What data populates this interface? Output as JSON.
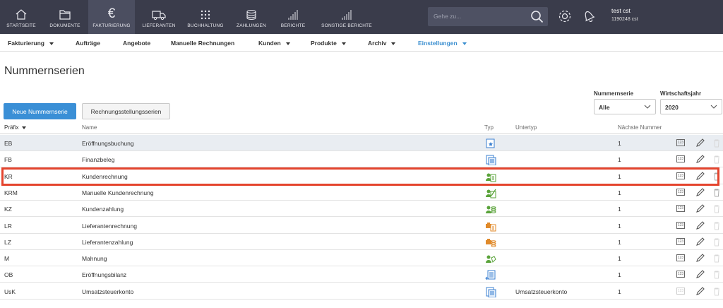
{
  "topnav": {
    "items": [
      {
        "label": "STARTSEITE",
        "icon": "home-icon"
      },
      {
        "label": "DOKUMENTE",
        "icon": "folder-icon"
      },
      {
        "label": "FAKTURIERUNG",
        "icon": "euro-icon"
      },
      {
        "label": "LIEFERANTEN",
        "icon": "truck-icon"
      },
      {
        "label": "BUCHHALTUNG",
        "icon": "grid-icon"
      },
      {
        "label": "ZAHLUNGEN",
        "icon": "coins-icon"
      },
      {
        "label": "BERICHTE",
        "icon": "bar-chart-icon"
      },
      {
        "label": "SONSTIGE BERICHTE",
        "icon": "bar-chart-icon"
      }
    ],
    "search_placeholder": "Gehe zu...",
    "user_name": "test cst",
    "user_id": "1190248 cst"
  },
  "subnav": {
    "items": [
      {
        "label": "Fakturierung",
        "dropdown": true
      },
      {
        "label": "Aufträge",
        "dropdown": false
      },
      {
        "label": "Angebote",
        "dropdown": false
      },
      {
        "label": "Manuelle Rechnungen",
        "dropdown": false
      },
      {
        "label": "Kunden",
        "dropdown": true
      },
      {
        "label": "Produkte",
        "dropdown": true
      },
      {
        "label": "Archiv",
        "dropdown": true
      },
      {
        "label": "Einstellungen",
        "dropdown": true
      }
    ]
  },
  "page": {
    "title": "Nummernserien",
    "new_button": "Neue Nummernserie",
    "series_button": "Rechnungsstellungsserien",
    "filter_label": "Nummernserie",
    "filter_value": "Alle",
    "year_label": "Wirtschaftsjahr",
    "year_value": "2020"
  },
  "table": {
    "headers": {
      "prefix": "Präfix",
      "name": "Name",
      "typ": "Typ",
      "untertyp": "Untertyp",
      "next": "Nächste Nummer"
    },
    "rows": [
      {
        "prefix": "EB",
        "name": "Eröffnungsbuchung",
        "untertyp": "",
        "next": "1",
        "icon": "opening-entry-icon"
      },
      {
        "prefix": "FB",
        "name": "Finanzbeleg",
        "untertyp": "",
        "next": "1",
        "icon": "finance-document-icon"
      },
      {
        "prefix": "KR",
        "name": "Kundenrechnung",
        "untertyp": "",
        "next": "1",
        "icon": "customer-invoice-icon"
      },
      {
        "prefix": "KRM",
        "name": "Manuelle Kundenrechnung",
        "untertyp": "",
        "next": "1",
        "icon": "manual-invoice-icon"
      },
      {
        "prefix": "KZ",
        "name": "Kundenzahlung",
        "untertyp": "",
        "next": "1",
        "icon": "customer-payment-icon"
      },
      {
        "prefix": "LR",
        "name": "Lieferantenrechnung",
        "untertyp": "",
        "next": "1",
        "icon": "supplier-invoice-icon"
      },
      {
        "prefix": "LZ",
        "name": "Lieferantenzahlung",
        "untertyp": "",
        "next": "1",
        "icon": "supplier-payment-icon"
      },
      {
        "prefix": "M",
        "name": "Mahnung",
        "untertyp": "",
        "next": "1",
        "icon": "reminder-icon"
      },
      {
        "prefix": "OB",
        "name": "Eröffnungsbilanz",
        "untertyp": "",
        "next": "1",
        "icon": "opening-balance-icon"
      },
      {
        "prefix": "UsK",
        "name": "Umsatzsteuerkonto",
        "untertyp": "Umsatzsteuerkonto",
        "next": "1",
        "icon": "vat-account-icon"
      }
    ]
  },
  "colors": {
    "topbar": "#3a3c4b",
    "accent": "#3a8fd6",
    "highlight": "#e4442d",
    "icon_green": "#5aa33a",
    "icon_blue": "#3a7fd0",
    "icon_orange": "#e08a2a"
  }
}
